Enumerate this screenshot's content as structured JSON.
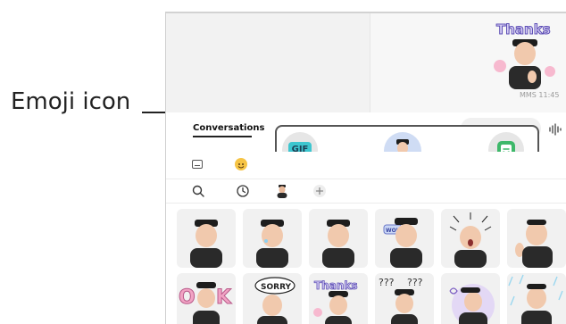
{
  "callout": {
    "label": "Emoji icon"
  },
  "chat": {
    "timestamp": "MMS 11:45",
    "sticker_caption": "Thanks"
  },
  "composer": {
    "conversations_tab": "Conversations"
  },
  "picker": {
    "gif_label": "GIF"
  },
  "stickers": {
    "labels": [
      "SORRY",
      "Thanks",
      "???",
      "WOW"
    ]
  },
  "colors": {
    "gif_bg": "#3dc6cf",
    "emoji_selected_bg": "#cfdcf4",
    "sticker_app_green": "#3eb86a",
    "add_red": "#e0403a"
  },
  "icons": {
    "voice": "waveform-icon",
    "keyboard": "keyboard-icon",
    "emoji": "smiley-icon",
    "search": "search-icon",
    "recent": "clock-icon",
    "avatar": "avatar-icon",
    "add": "plus-icon"
  }
}
